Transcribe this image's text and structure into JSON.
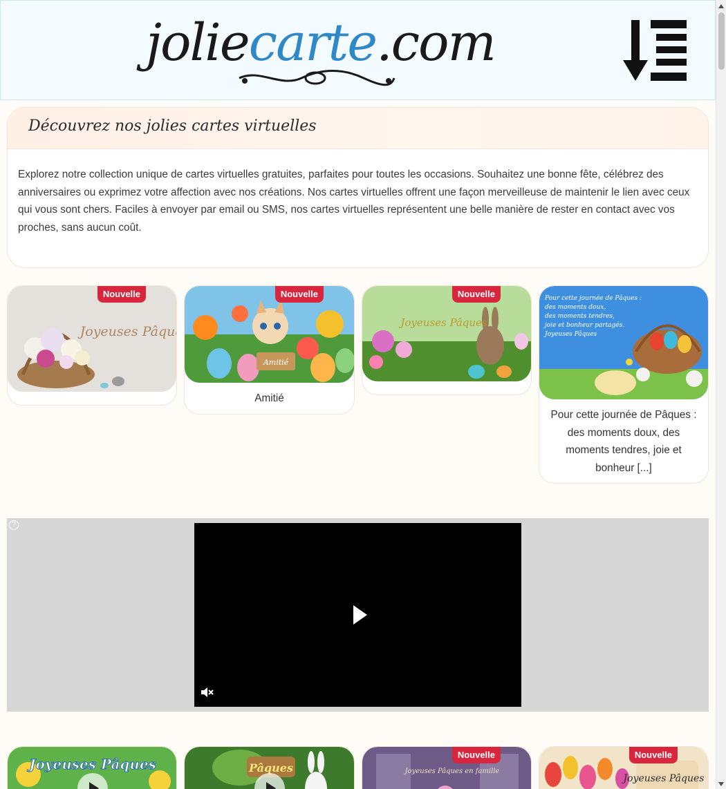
{
  "header": {
    "logo_part1": "jolie",
    "logo_part2": "carte",
    "logo_part3": ".com",
    "menu_icon": "sort-down-list-icon"
  },
  "intro": {
    "title": "Découvrez nos jolies cartes virtuelles",
    "text": "Explorez notre collection unique de cartes virtuelles gratuites, parfaites pour toutes les occasions. Souhaitez une bonne fête, célébrez des anniversaires ou exprimez votre affection avec nos créations. Nos cartes virtuelles offrent une façon merveilleuse de maintenir le lien avec ceux qui vous sont chers. Faciles à envoyer par email ou SMS, nos cartes virtuelles représentent une belle manière de rester en contact avec vos proches, sans aucun coût."
  },
  "cards_row1": [
    {
      "badge": "Nouvelle",
      "image_text": "Joyeuses Pâques",
      "caption": ""
    },
    {
      "badge": "Nouvelle",
      "image_text": "Amitié",
      "caption": "Amitié"
    },
    {
      "badge": "Nouvelle",
      "image_text": "Joyeuses Pâques",
      "caption": ""
    },
    {
      "badge": "",
      "image_text": "Pour cette journée de Pâques : des moments doux, des moments tendres, joie et bonheur partagés. Joyeuses Pâques",
      "caption": "Pour cette journée de Pâques : des moments doux, des moments tendres, joie et bonheur [...]"
    }
  ],
  "ad": {
    "help_icon": "question-circle-icon",
    "help_label": "?",
    "play_icon": "play-icon",
    "mute_icon": "muted-speaker-icon"
  },
  "cards_row2": [
    {
      "badge": "",
      "image_text": "Joyeuses Pâques"
    },
    {
      "badge": "",
      "image_text": "Pâques"
    },
    {
      "badge": "Nouvelle",
      "image_text": "Joyeuses Pâques en famille"
    },
    {
      "badge": "Nouvelle",
      "image_text": "Joyeuses Pâques !"
    }
  ],
  "colors": {
    "header_bg": "#f3fbff",
    "logo_accent": "#2f88c8",
    "badge": "#d7263d",
    "ad_bg": "#d6d6d6"
  }
}
